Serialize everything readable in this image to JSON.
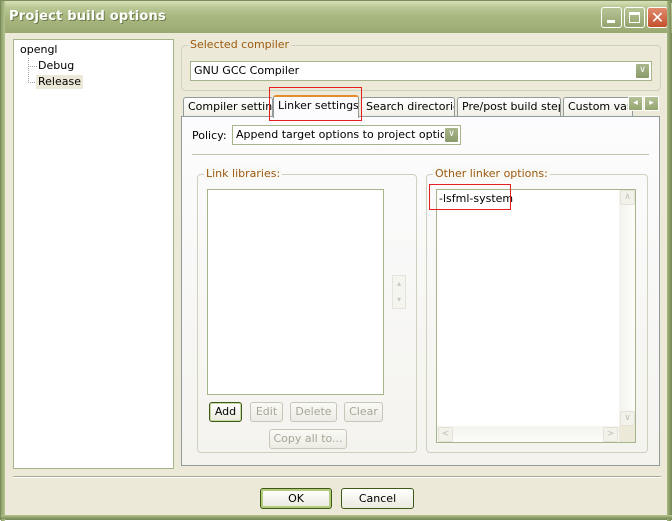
{
  "window": {
    "title": "Project build options",
    "controls": {
      "minimize": "minimize-icon",
      "maximize": "maximize-icon",
      "close": "close-icon"
    }
  },
  "tree": {
    "root": "opengl",
    "children": [
      "Debug",
      "Release"
    ],
    "selected": "Release"
  },
  "compiler": {
    "group_label": "Selected compiler",
    "value": "GNU GCC Compiler",
    "dropdown_glyph": "∨"
  },
  "tabs": [
    {
      "label": "Compiler settings",
      "active": false
    },
    {
      "label": "Linker settings",
      "active": true
    },
    {
      "label": "Search directories",
      "active": false
    },
    {
      "label": "Pre/post build steps",
      "active": false
    },
    {
      "label": "Custom variables",
      "active": false
    }
  ],
  "tab_scroll": {
    "left": "◂",
    "right": "▸"
  },
  "linker": {
    "policy_label": "Policy:",
    "policy_value": "Append target options to project options",
    "link_libraries": {
      "label": "Link libraries:",
      "items": [],
      "buttons": {
        "add": "Add",
        "edit": "Edit",
        "delete": "Delete",
        "clear": "Clear",
        "copy_all": "Copy all to..."
      },
      "move_up": "▴",
      "move_down": "▾"
    },
    "other_options": {
      "label": "Other linker options:",
      "value": "-lsfml-system"
    }
  },
  "scroll_glyphs": {
    "up": "∧",
    "down": "∨",
    "left": "<",
    "right": ">"
  },
  "footer": {
    "ok": "OK",
    "cancel": "Cancel"
  },
  "annotation_color": "#e62020"
}
